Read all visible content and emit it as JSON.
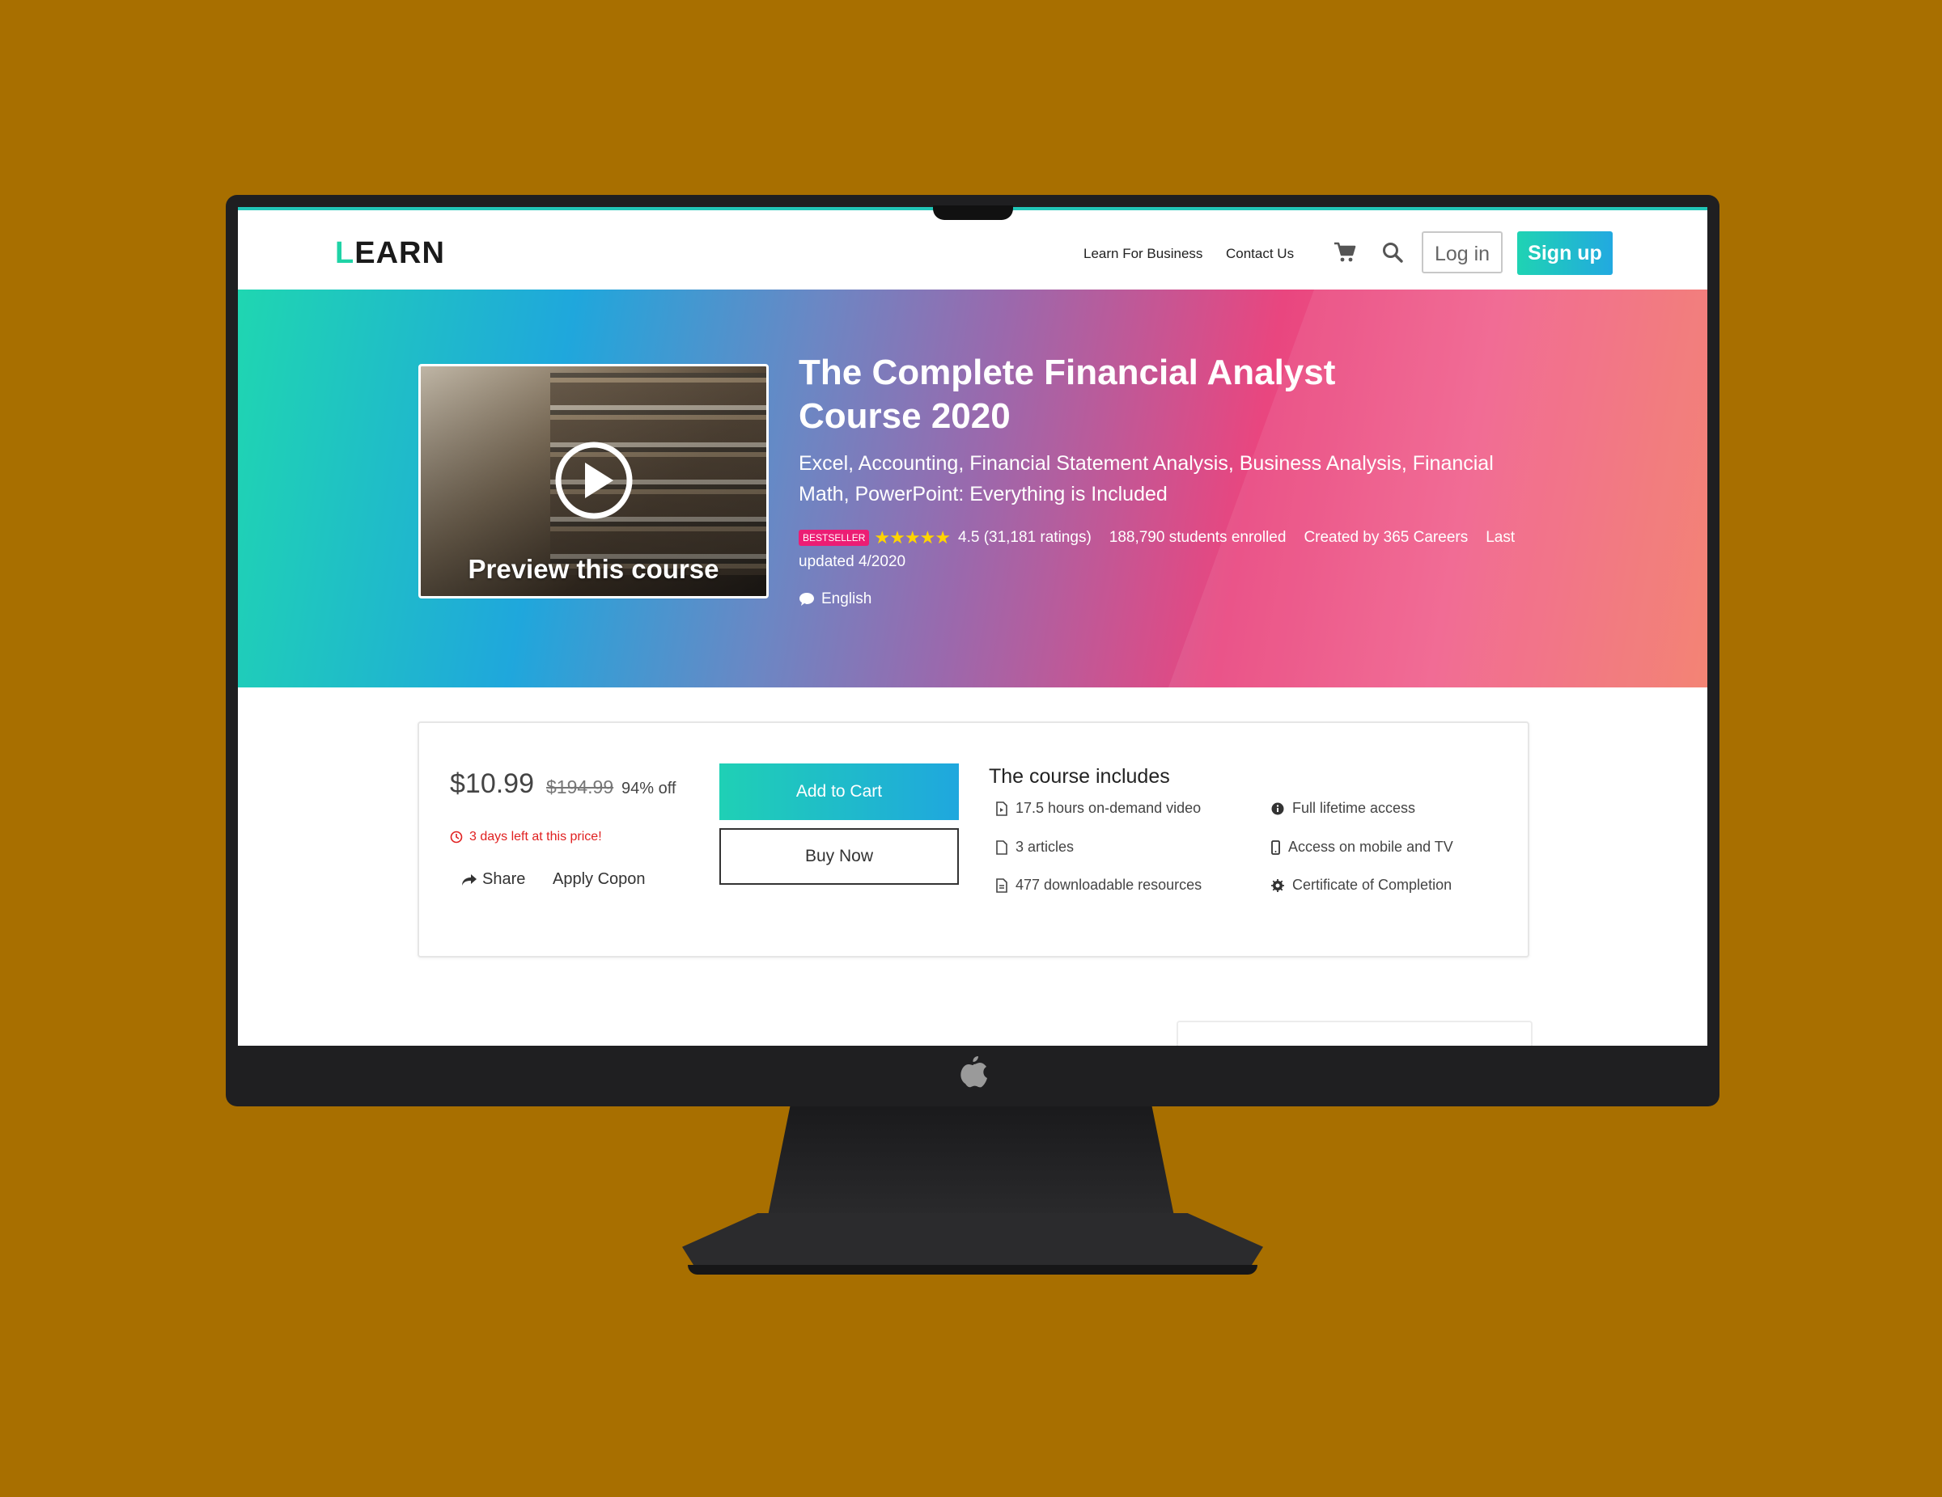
{
  "nav": {
    "logo_first": "L",
    "logo_rest": "EARN",
    "links": [
      "Learn For Business",
      "Contact Us"
    ],
    "login": "Log in",
    "signup": "Sign up"
  },
  "hero": {
    "preview_label": "Preview this course",
    "title": "The Complete Financial Analyst Course 2020",
    "subtitle": "Excel, Accounting, Financial Statement Analysis, Business Analysis, Financial Math, PowerPoint: Everything is Included",
    "badge": "BESTSELLER",
    "stars": "★★★★★",
    "rating": "4.5 (31,181 ratings)",
    "students": "188,790 students enrolled",
    "created_by": "Created by 365 Careers",
    "updated": "Last updated 4/2020",
    "language": "English"
  },
  "purchase": {
    "price": "$10.99",
    "old_price": "$194.99",
    "discount": "94% off",
    "timer": "3 days left at this price!",
    "share": "Share",
    "coupon": "Apply Copon",
    "add_to_cart": "Add to Cart",
    "buy_now": "Buy Now"
  },
  "includes": {
    "title": "The course includes",
    "items": [
      "17.5 hours on-demand video",
      "3 articles",
      "477 downloadable resources",
      "Full lifetime access",
      "Access on mobile and TV",
      "Certificate of Completion"
    ]
  },
  "colors": {
    "background": "#a86f00",
    "accent_teal": "#1fd3a6",
    "accent_blue": "#1fa7de",
    "accent_pink": "#ec1d74",
    "timer_red": "#e02020"
  },
  "icons": [
    "cart-icon",
    "search-icon",
    "play-icon",
    "chat-icon",
    "clock-icon",
    "share-icon",
    "file-video-icon",
    "file-icon",
    "file-download-icon",
    "info-icon",
    "mobile-icon",
    "certificate-icon",
    "apple-logo"
  ]
}
